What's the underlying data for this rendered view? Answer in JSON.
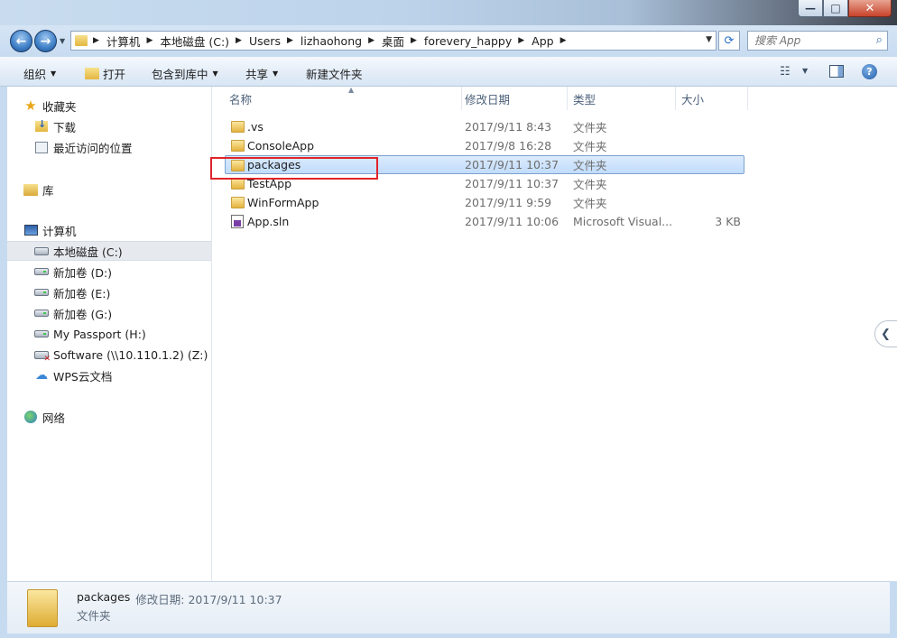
{
  "window": {
    "min_glyph": "—",
    "max_glyph": "□",
    "close_glyph": "✕"
  },
  "address": {
    "crumbs": [
      "计算机",
      "本地磁盘 (C:)",
      "Users",
      "lizhaohong",
      "桌面",
      "forevery_happy",
      "App"
    ],
    "search_placeholder": "搜索 App"
  },
  "toolbar": {
    "organize": "组织",
    "open": "打开",
    "include_library": "包含到库中",
    "share": "共享",
    "new_folder": "新建文件夹"
  },
  "nav": {
    "favorites": "收藏夹",
    "downloads": "下载",
    "recent": "最近访问的位置",
    "libraries": "库",
    "computer": "计算机",
    "drives": [
      {
        "label": "本地磁盘 (C:)"
      },
      {
        "label": "新加卷 (D:)"
      },
      {
        "label": "新加卷 (E:)"
      },
      {
        "label": "新加卷 (G:)"
      },
      {
        "label": "My Passport (H:)"
      },
      {
        "label": "Software (\\\\10.110.1.2) (Z:)"
      },
      {
        "label": "WPS云文档"
      }
    ],
    "network": "网络"
  },
  "columns": {
    "name": "名称",
    "date": "修改日期",
    "type": "类型",
    "size": "大小"
  },
  "files": [
    {
      "name": ".vs",
      "date": "2017/9/11 8:43",
      "type": "文件夹",
      "size": ""
    },
    {
      "name": "ConsoleApp",
      "date": "2017/9/8 16:28",
      "type": "文件夹",
      "size": ""
    },
    {
      "name": "packages",
      "date": "2017/9/11 10:37",
      "type": "文件夹",
      "size": ""
    },
    {
      "name": "TestApp",
      "date": "2017/9/11 10:37",
      "type": "文件夹",
      "size": ""
    },
    {
      "name": "WinFormApp",
      "date": "2017/9/11 9:59",
      "type": "文件夹",
      "size": ""
    },
    {
      "name": "App.sln",
      "date": "2017/9/11 10:06",
      "type": "Microsoft Visual...",
      "size": "3 KB"
    }
  ],
  "details": {
    "name": "packages",
    "meta": "修改日期: 2017/9/11 10:37",
    "type": "文件夹"
  },
  "colors": {
    "highlight_box": "#e0242a",
    "selection": "#c1dcfc"
  }
}
